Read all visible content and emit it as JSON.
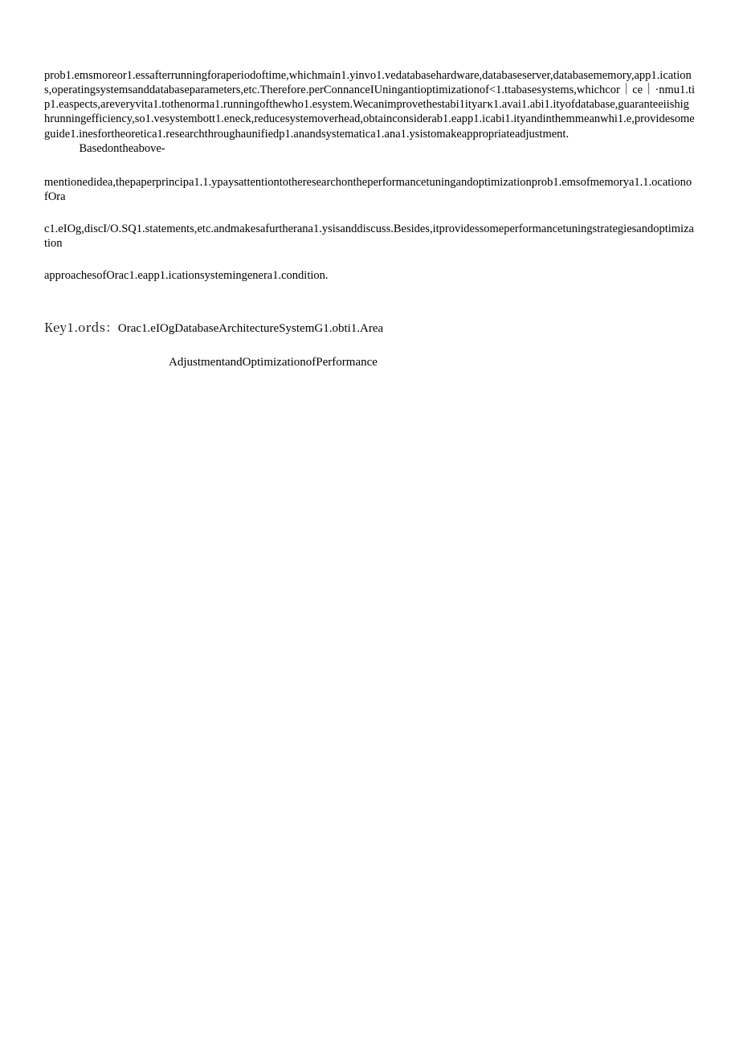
{
  "abstract": {
    "para1": "prob1.emsmoreor1.essafterrunningforaperiodoftime,whichmain1.yinvo1.vedatabasehardware,databaseserver,databasememory,app1.ications,operatingsystemsanddatabaseparameters,etc.Therefore.perConnanceIUningantioptimizationof<1.ttabasesystems,whichcor｜ce｜·nmu1.tip1.easpects,areveryvita1.tothenorma1.runningofthewho1.esystem.Wecanimprovethestabi1ityaгκ1.avai1.abi1.ityofdatabase,guaranteeiishighrunningefficiency,so1.vesystembott1.eneck,reducesystemoverhead,obtainconsiderab1.eapp1.icabi1.ityandinthemmeanwhi1.e,providesomeguide1.inesfortheoretica1.researchthroughaunifiedp1.anandsystematica1.ana1.ysistomakeappropriateadjustment.",
    "para2_prefix": "Basedontheabove-",
    "lineA": "mentionedidea,thepaperprincipa1.1.ypaysattentiontotheresearchontheperformancetuningandoptimizationprob1.emsofmemorya1.1.ocationofOra",
    "lineB": "c1.eIOg,discI/O.SQ1.statements,etc.andmakesafurtherana1.ysisanddiscuss.Besides,itprovidessomeperformancetuningstrategiesandoptimization",
    "lineC": "approachesofOrac1.eapp1.icationsystemingenera1.condition."
  },
  "keywords": {
    "label": "Key1.ords：",
    "value1": "Orac1.eIOgDatabaseArchitectureSystemG1.obti1.Area",
    "value2": "AdjustmentandOptimizationofPerformance"
  }
}
